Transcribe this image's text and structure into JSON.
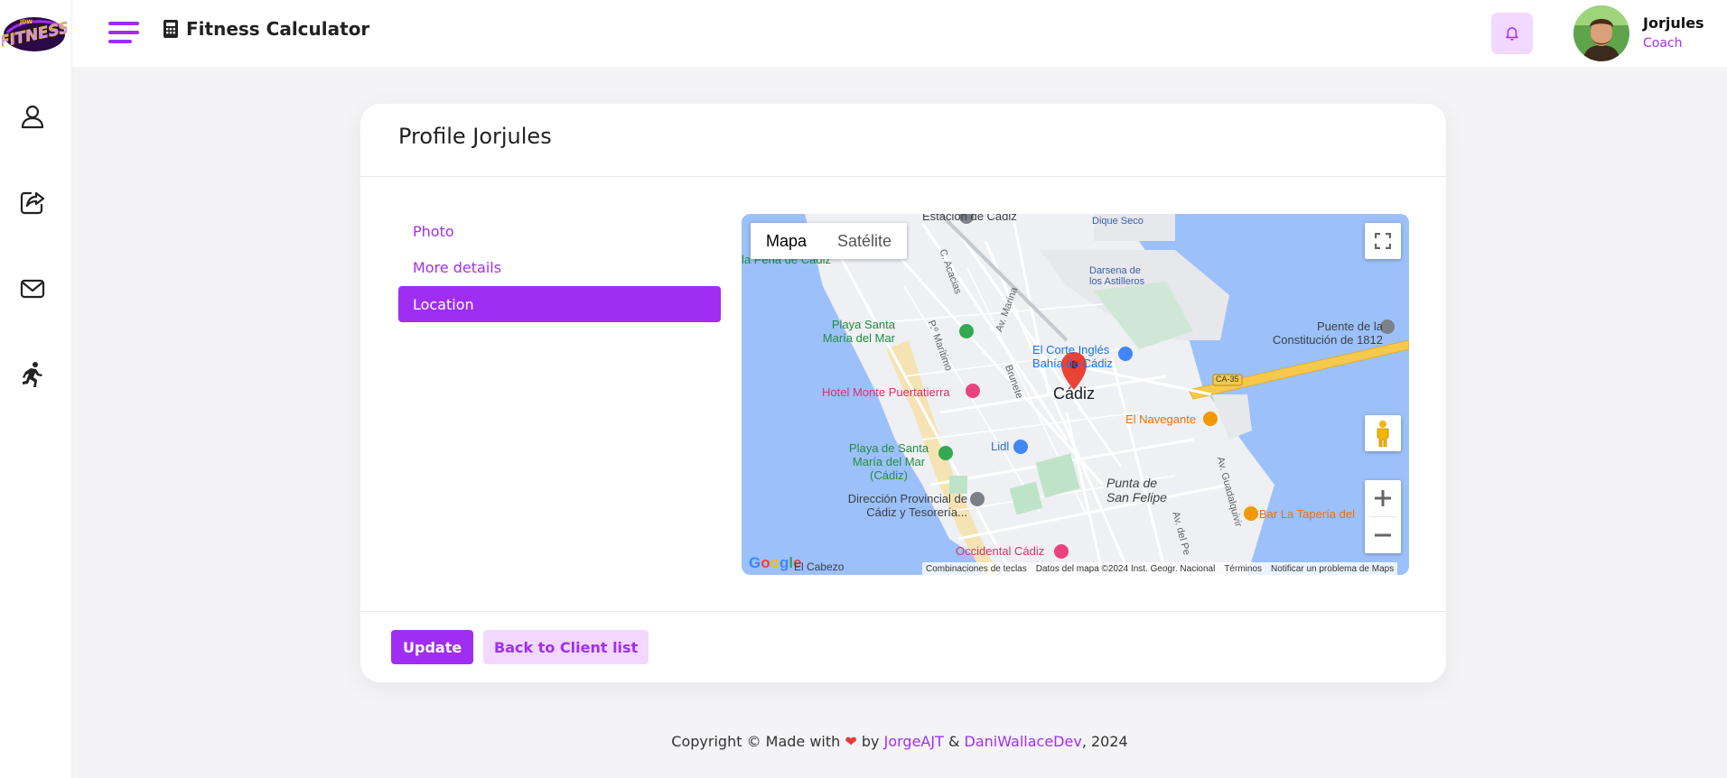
{
  "app": {
    "title": "Fitness Calculator",
    "logo_text": "JDW FITNESS"
  },
  "sidebar": {
    "items": [
      {
        "icon": "user-icon"
      },
      {
        "icon": "share-icon"
      },
      {
        "icon": "mail-icon"
      },
      {
        "icon": "running-icon"
      }
    ]
  },
  "user": {
    "name": "Jorjules",
    "role": "Coach"
  },
  "card": {
    "title": "Profile Jorjules",
    "tabs": [
      {
        "label": "Photo",
        "active": false
      },
      {
        "label": "More details",
        "active": false
      },
      {
        "label": "Location",
        "active": true
      }
    ],
    "buttons": {
      "update": "Update",
      "back": "Back to Client list"
    }
  },
  "map": {
    "type_map": "Mapa",
    "type_satellite": "Satélite",
    "labels": {
      "estacion": "Estación de Cádiz",
      "dique": "Dique Seco",
      "pena": "la Peña de Cádiz",
      "darsena": "Darsena de los Astilleros",
      "puente": "Puente de la Constitución de 1812",
      "playa1": "Playa Santa María del Mar",
      "corte": "El Corte Inglés Bahía de Cádiz",
      "ca35": "CA-35",
      "hotel": "Hotel Monte Puertatierra",
      "cadiz": "Cádiz",
      "navegante": "El Navegante",
      "lidl": "Lidl",
      "playa2": "Playa de Santa María del Mar (Cádiz)",
      "punta": "Punta de San Felipe",
      "direccion": "Dirección Provincial de Cádiz y Tesorería...",
      "bar": "Bar La Tapería del",
      "occidental": "Occidental Cádiz",
      "cabezo": "El Cabezo",
      "acacias": "C. Acacias",
      "marina": "Av. Marina",
      "maritimo": "P.º Marítimo",
      "brunete": "Brunete",
      "guadalquivir": "Av. Guadalquivir",
      "del_pe": "Av. del Pe"
    },
    "footer": {
      "shortcuts": "Combinaciones de teclas",
      "data": "Datos del mapa ©2024 Inst. Geogr. Nacional",
      "terms": "Términos",
      "report": "Notificar un problema de Maps"
    },
    "google": "Google"
  },
  "footer": {
    "prefix": "Copyright © Made with",
    "heart": "❤",
    "by": "by",
    "author1": "JorgeAJT",
    "amp": "&",
    "author2": "DaniWallaceDev",
    "year": ", 2024"
  }
}
